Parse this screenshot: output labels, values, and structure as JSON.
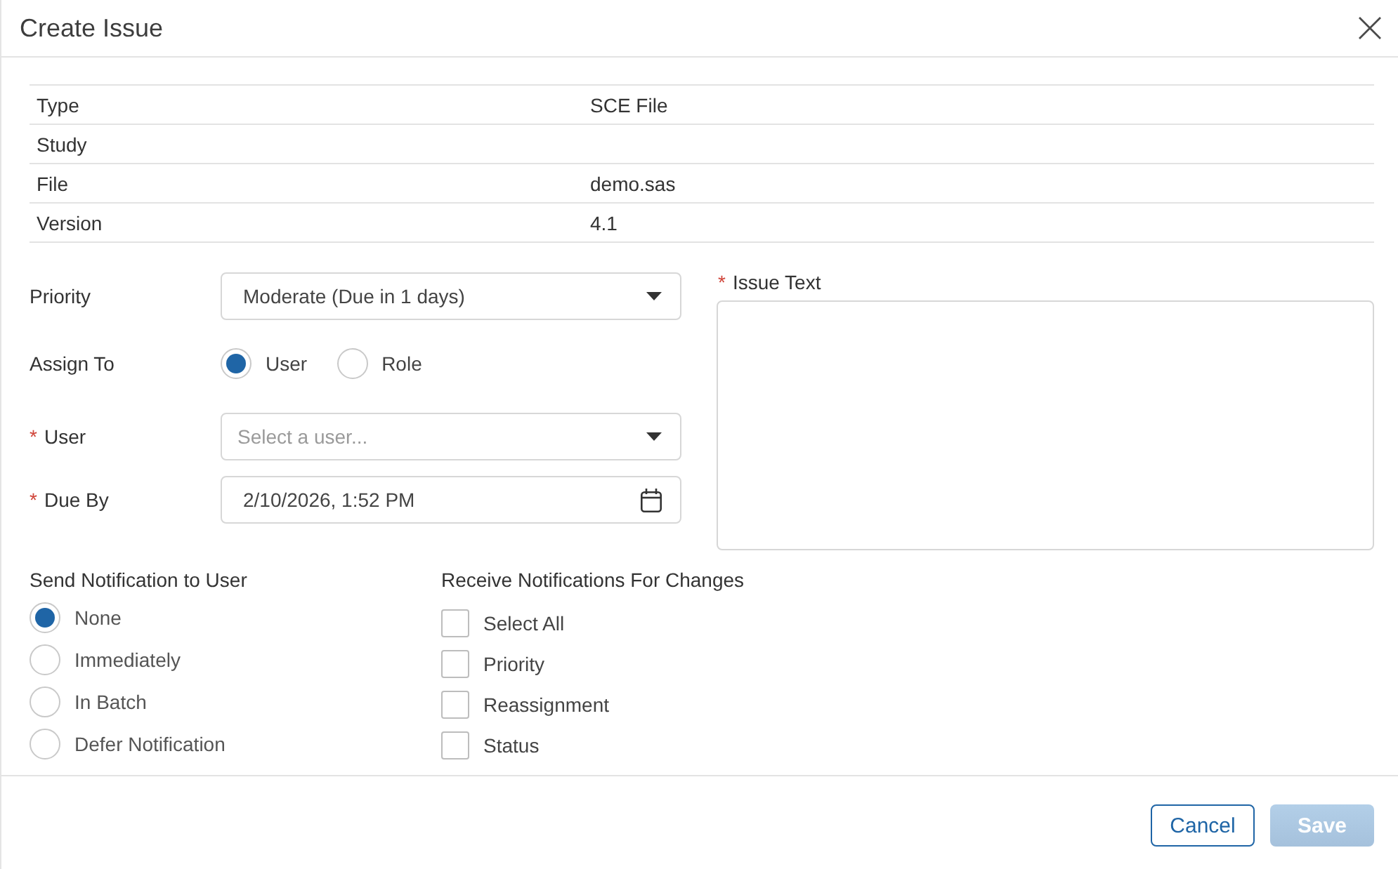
{
  "dialog": {
    "title": "Create Issue"
  },
  "details": [
    {
      "label": "Type",
      "value": "SCE File"
    },
    {
      "label": "Study"
    },
    {
      "label": "File",
      "value": "demo.sas"
    },
    {
      "label": "Version",
      "value": "4.1"
    }
  ],
  "form": {
    "priority": {
      "label": "Priority",
      "value": "Moderate (Due in 1 days)"
    },
    "assign_to": {
      "label": "Assign To",
      "options": [
        {
          "label": "User",
          "selected": true
        },
        {
          "label": "Role",
          "selected": false
        }
      ]
    },
    "user": {
      "marker": "*",
      "label": "User",
      "placeholder": "Select a user..."
    },
    "due_by": {
      "marker": "*",
      "label": "Due By",
      "value": "2/10/2026, 1:52 PM"
    },
    "issue_text": {
      "marker": "*",
      "label": "Issue Text"
    }
  },
  "send_notification": {
    "label": "Send Notification to User",
    "options": [
      {
        "label": "None",
        "selected": true
      },
      {
        "label": "Immediately",
        "selected": false
      },
      {
        "label": "In Batch",
        "selected": false
      },
      {
        "label": "Defer Notification",
        "selected": false
      }
    ]
  },
  "receive_notifications": {
    "label": "Receive Notifications For Changes",
    "options": [
      {
        "label": "Select All",
        "checked": false
      },
      {
        "label": "Priority",
        "checked": false
      },
      {
        "label": "Reassignment",
        "checked": false
      },
      {
        "label": "Status",
        "checked": false
      }
    ]
  },
  "buttons": [
    {
      "label": "Cancel",
      "kind": "secondary",
      "disabled": false
    },
    {
      "label": "Save",
      "kind": "primary",
      "disabled": true
    }
  ]
}
